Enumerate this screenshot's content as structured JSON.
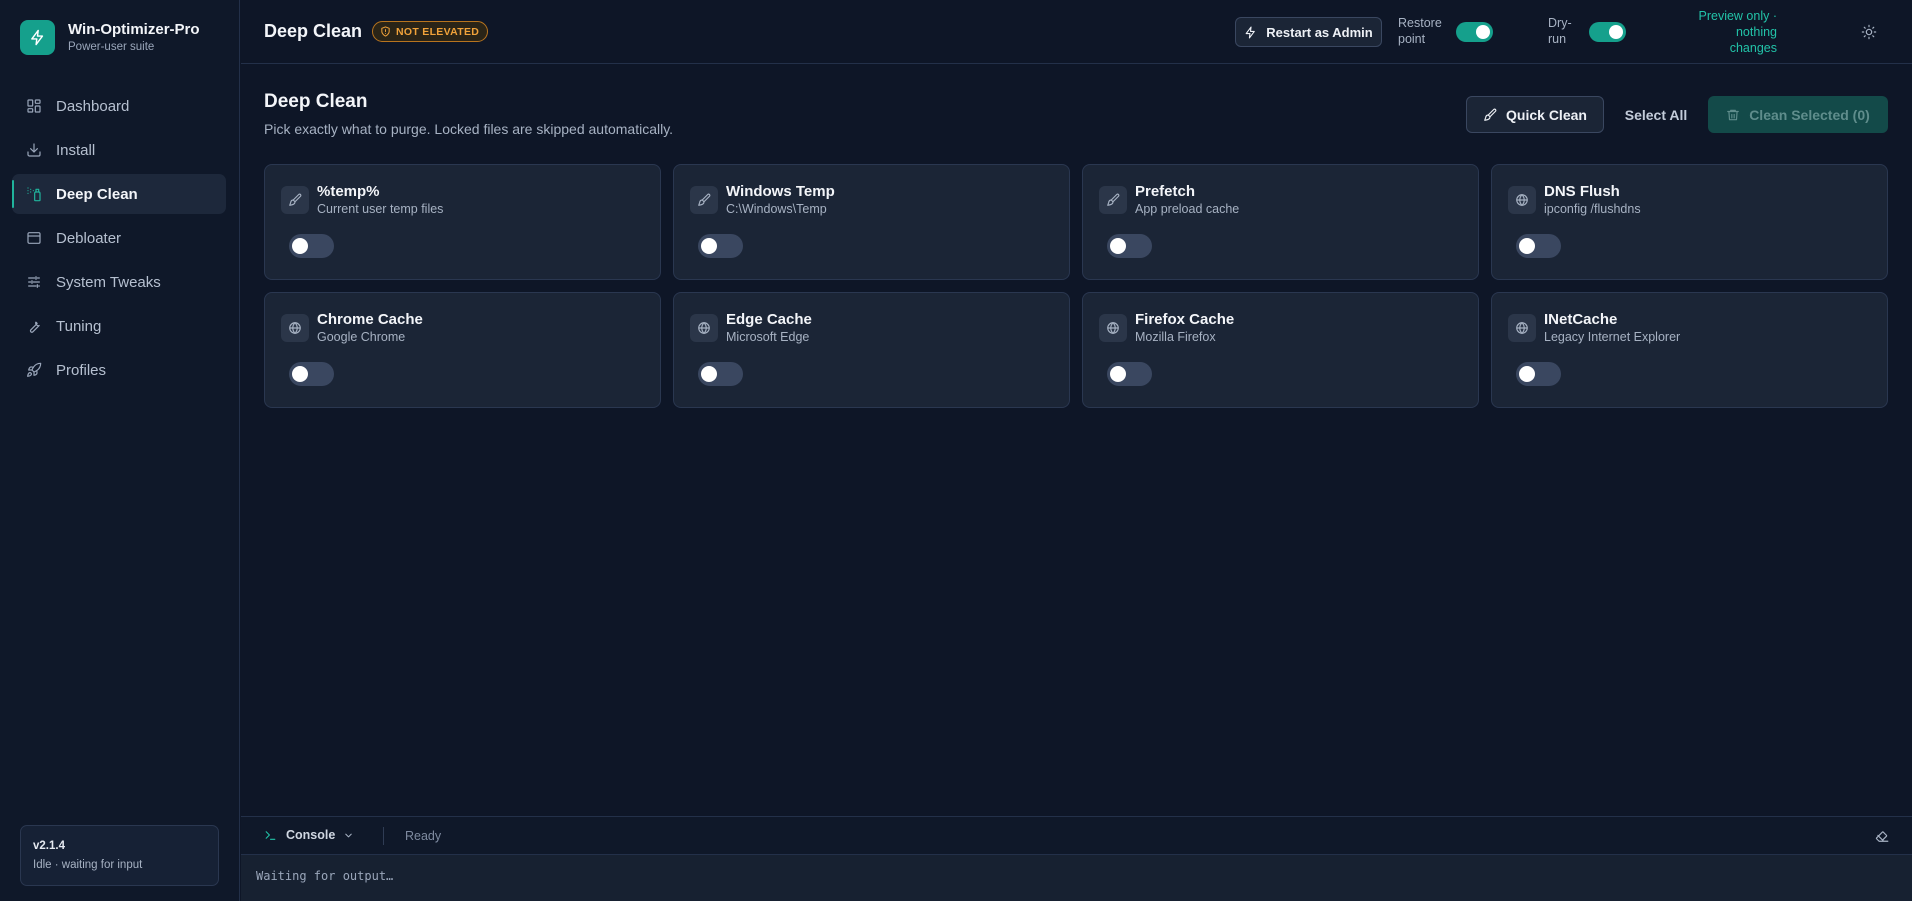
{
  "app": {
    "name": "Win-Optimizer-Pro",
    "subtitle": "Power-user suite",
    "accent": "#15a08c"
  },
  "sidebar": {
    "items": [
      {
        "label": "Dashboard",
        "icon": "grid-icon"
      },
      {
        "label": "Install",
        "icon": "download-icon"
      },
      {
        "label": "Deep Clean",
        "icon": "spray-icon",
        "active": true
      },
      {
        "label": "Debloater",
        "icon": "window-icon"
      },
      {
        "label": "System Tweaks",
        "icon": "sliders-icon"
      },
      {
        "label": "Tuning",
        "icon": "wrench-icon"
      },
      {
        "label": "Profiles",
        "icon": "rocket-icon"
      }
    ],
    "version": "v2.1.4",
    "status": "Idle · waiting for input"
  },
  "header": {
    "title": "Deep Clean",
    "badge": "NOT ELEVATED",
    "badge_color": "#f0a23a",
    "restart_label": "Restart as Admin",
    "restore_label_1": "Restore",
    "restore_label_2": "point",
    "restore_on": true,
    "dryrun_label_1": "Dry-",
    "dryrun_label_2": "run",
    "dryrun_on": true,
    "preview_line1": "Preview only ·",
    "preview_line2": "nothing",
    "preview_line3": "changes",
    "theme_icon": "sun-icon"
  },
  "main": {
    "title": "Deep Clean",
    "subtitle": "Pick exactly what to purge. Locked files are skipped automatically.",
    "quick_clean_label": "Quick Clean",
    "select_all_label": "Select All",
    "clean_selected_label": "Clean Selected (0)",
    "cards": [
      {
        "title": "%temp%",
        "desc": "Current user temp files",
        "icon": "brush-icon",
        "enabled": false
      },
      {
        "title": "Windows Temp",
        "desc": "C:\\Windows\\Temp",
        "icon": "brush-icon",
        "enabled": false
      },
      {
        "title": "Prefetch",
        "desc": "App preload cache",
        "icon": "brush-icon",
        "enabled": false
      },
      {
        "title": "DNS Flush",
        "desc": "ipconfig /flushdns",
        "icon": "globe-icon",
        "enabled": false
      },
      {
        "title": "Chrome Cache",
        "desc": "Google Chrome",
        "icon": "globe-icon",
        "enabled": false
      },
      {
        "title": "Edge Cache",
        "desc": "Microsoft Edge",
        "icon": "globe-icon",
        "enabled": false
      },
      {
        "title": "Firefox Cache",
        "desc": "Mozilla Firefox",
        "icon": "globe-icon",
        "enabled": false
      },
      {
        "title": "INetCache",
        "desc": "Legacy Internet Explorer",
        "icon": "globe-icon",
        "enabled": false
      }
    ]
  },
  "console": {
    "tab_label": "Console",
    "status": "Ready",
    "output": "Waiting for output…"
  }
}
